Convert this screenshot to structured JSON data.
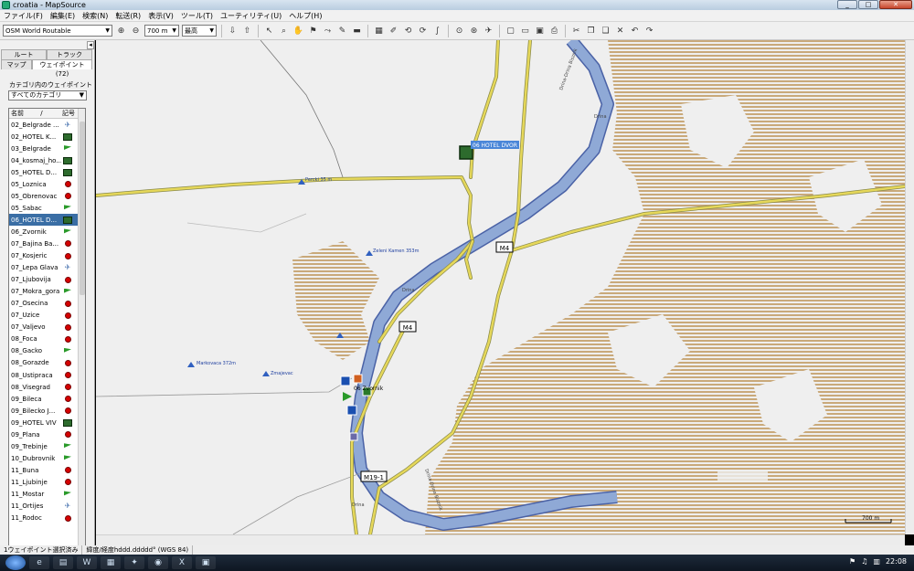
{
  "window": {
    "title": "croatia - MapSource"
  },
  "menu": [
    "ファイル(F)",
    "編集(E)",
    "検索(N)",
    "転送(R)",
    "表示(V)",
    "ツール(T)",
    "ユーティリティ(U)",
    "ヘルプ(H)"
  ],
  "toolbar": {
    "map_product": "OSM World Routable",
    "zoom_value": "700 m",
    "detail_value": "最高"
  },
  "sidebar": {
    "tabs_top": [
      "ルート",
      "トラック"
    ],
    "tabs_bottom": [
      "マップ",
      "ウェイポイント (72)"
    ],
    "category_label": "カテゴリ内のウェイポイントの表",
    "category_value": "すべてのカテゴリ",
    "col_name": "名前",
    "col_sort": "/",
    "col_symbol": "記号",
    "rows": [
      {
        "name": "02_Belgrade ...",
        "sym": "plane"
      },
      {
        "name": "02_HOTEL K...",
        "sym": "hotel"
      },
      {
        "name": "03_Belgrade",
        "sym": "flag"
      },
      {
        "name": "04_kosmaj_ho...",
        "sym": "hotel"
      },
      {
        "name": "05_HOTEL D...",
        "sym": "hotel"
      },
      {
        "name": "05_Loznica",
        "sym": "pin"
      },
      {
        "name": "05_Obrenovac",
        "sym": "pin"
      },
      {
        "name": "05_Sabac",
        "sym": "flag"
      },
      {
        "name": "06_HOTEL D...",
        "sym": "hotel",
        "selected": true
      },
      {
        "name": "06_Zvornik",
        "sym": "flag"
      },
      {
        "name": "07_Bajina Ba...",
        "sym": "pin"
      },
      {
        "name": "07_Kosjeric",
        "sym": "pin"
      },
      {
        "name": "07_Lepa Glava",
        "sym": "plane"
      },
      {
        "name": "07_Ljubovija",
        "sym": "pin"
      },
      {
        "name": "07_Mokra_gora",
        "sym": "flag"
      },
      {
        "name": "07_Osecina",
        "sym": "pin"
      },
      {
        "name": "07_Uzice",
        "sym": "pin"
      },
      {
        "name": "07_Valjevo",
        "sym": "pin"
      },
      {
        "name": "08_Foca",
        "sym": "pin"
      },
      {
        "name": "08_Gacko",
        "sym": "flag"
      },
      {
        "name": "08_Gorazde",
        "sym": "pin"
      },
      {
        "name": "08_Ustipraca",
        "sym": "pin"
      },
      {
        "name": "08_Visegrad",
        "sym": "pin"
      },
      {
        "name": "09_Bileca",
        "sym": "pin"
      },
      {
        "name": "09_Bilecko J...",
        "sym": "pin"
      },
      {
        "name": "09_HOTEL VIV",
        "sym": "hotel"
      },
      {
        "name": "09_Plana",
        "sym": "pin"
      },
      {
        "name": "09_Trebinje",
        "sym": "flag"
      },
      {
        "name": "10_Dubrovnik",
        "sym": "flag"
      },
      {
        "name": "11_Buna",
        "sym": "pin"
      },
      {
        "name": "11_Ljubinje",
        "sym": "pin"
      },
      {
        "name": "11_Mostar",
        "sym": "flag"
      },
      {
        "name": "11_Ortijes",
        "sym": "plane"
      },
      {
        "name": "11_Rodoc",
        "sym": "pin"
      }
    ]
  },
  "map": {
    "selected_waypoint": "06 HOTEL DVOR",
    "road_m4": "M4",
    "road_m19": "M19-1",
    "town": "06 Zvornik",
    "peaks": [
      "Percki 35 m",
      "Zeleni Kamen 353m",
      "Markovaca 372m",
      "Zmajevac"
    ],
    "river_labels": [
      "Drina",
      "Drina-Drina Bisznik",
      "Drina",
      "Drina-Drina Bisznik"
    ],
    "scale": "700 m"
  },
  "status": {
    "selection": "1ウェイポイント選択済み",
    "coord_format": "緯度/経度hddd.ddddd° (WGS 84)"
  },
  "taskbar": {
    "clock": "22:08"
  },
  "colors": {
    "river": "#8fa9d6",
    "river_edge": "#4a62a6",
    "road_main": "#e6d85a",
    "road_edge": "#8a8a4a",
    "hatch": "#c9a97a",
    "map_bg": "#efefef"
  }
}
